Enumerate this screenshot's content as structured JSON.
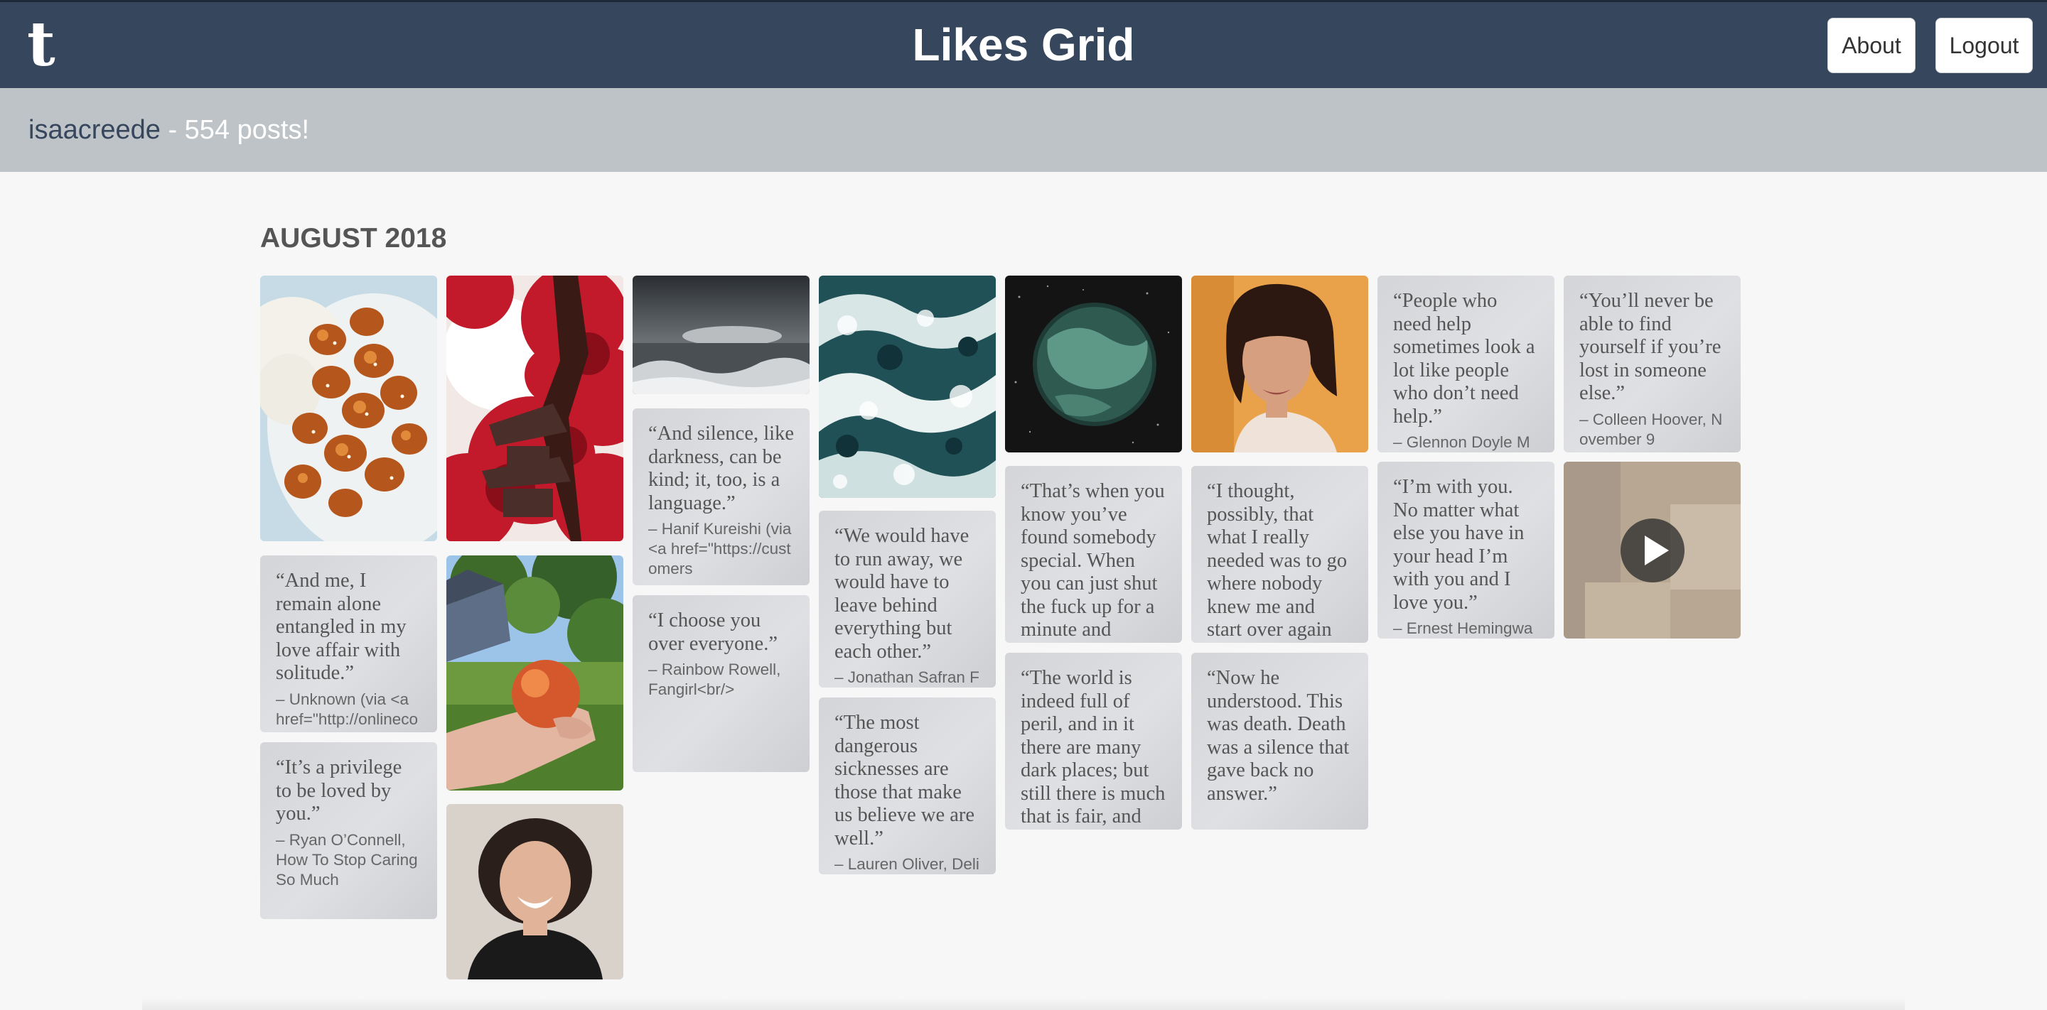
{
  "app": {
    "logo_letter": "t",
    "title": "Likes Grid",
    "nav": {
      "about": "About",
      "logout": "Logout"
    }
  },
  "user": {
    "username": "isaacreede",
    "posts_text": " - 554 posts!"
  },
  "month_heading": "AUGUST 2018",
  "quotes": [
    {
      "body": "“And me, I remain alone entangled in my love affair with solitude.”",
      "source": "– Unknown (via <a href=\"http://onlinecounselorzen.tumblr.com\" class=\"tumblr_blog\">"
    },
    {
      "body": "“It’s a privilege to be loved by you.”",
      "source": "– Ryan O’Connell, How To Stop Caring So Much"
    },
    {
      "body": "“And silence, like darkness, can be kind; it, too, is a language.”",
      "source": "– Hanif Kureishi (via <a href=\"https://customers"
    },
    {
      "body": "“I choose you over everyone.”",
      "source": "– Rainbow Rowell, Fangirl<br/>"
    },
    {
      "body": "“We would have to run away, we would have to leave behind everything but each other.”",
      "source": "– Jonathan Safran Foer, Everything Is"
    },
    {
      "body": "“The most dangerous sicknesses are those that make us believe we are well.”",
      "source": "– Lauren Oliver, Delirium"
    },
    {
      "body": "“That’s when you know you’ve found somebody special. When you can just shut the fuck up for a minute and comfortably",
      "source": ""
    },
    {
      "body": "“The world is indeed full of peril, and in it there are many dark places; but still there is much that is fair, and though",
      "source": ""
    },
    {
      "body": "“I thought, possibly, that what I really needed was to go where nobody knew me and start over again with",
      "source": ""
    },
    {
      "body": "“Now he understood. This was death. Death was a silence that gave back no answer.”",
      "source": ""
    },
    {
      "body": "“People who need help sometimes look a lot like people who don’t need help.”",
      "source": "– Glennon Doyle Melton, Carry On"
    },
    {
      "body": "“I’m with you. No matter what else you have in your head I’m with you and I love you.”",
      "source": "– Ernest Hemingway, The Garden of Eden"
    },
    {
      "body": "“You’ll never be able to find yourself if you’re lost in someone else.”",
      "source": "– Colleen Hoover, November 9"
    }
  ],
  "images": {
    "food": "food-photo",
    "tree": "red-tree-pagoda-photo",
    "sea_dark": "stormy-sea-photo",
    "apple": "hand-holding-apple-photo",
    "woman_smile": "smiling-woman-photo",
    "waves": "ocean-waves-photo",
    "planet": "green-planet-photo",
    "woman_portrait": "woman-portrait-photo",
    "video": "video-thumbnail"
  },
  "colors": {
    "header_bg": "#36465d",
    "subbar_bg": "#bec3c7",
    "quote_bg": "#d8d9dc",
    "page_bg": "#f7f7f7"
  }
}
